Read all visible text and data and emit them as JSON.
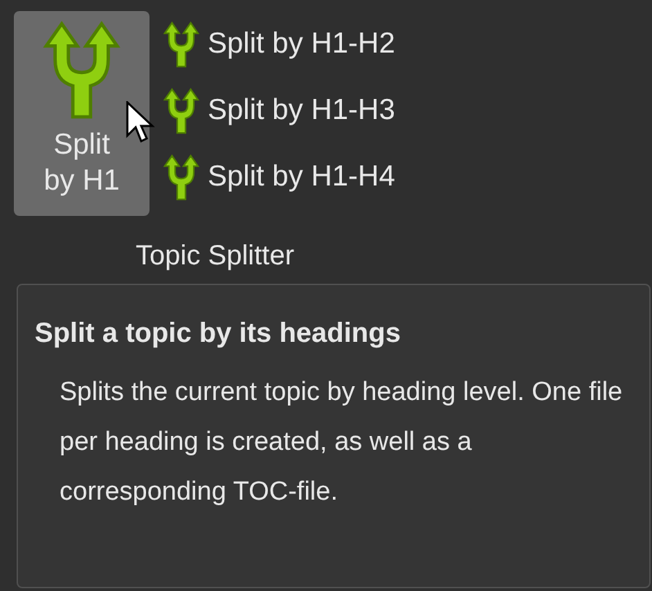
{
  "ribbon": {
    "large_button": {
      "label": "Split\nby H1",
      "hovered": true
    },
    "small_buttons": [
      {
        "label": "Split by H1-H2"
      },
      {
        "label": "Split by H1-H3"
      },
      {
        "label": "Split by H1-H4"
      }
    ],
    "group_label": "Topic Splitter"
  },
  "tooltip": {
    "title": "Split a topic by its headings",
    "body": "Splits the current topic by heading level. One file per heading is created, as well as a corresponding TOC-file."
  }
}
